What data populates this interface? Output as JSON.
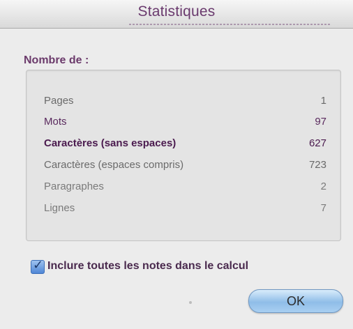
{
  "window": {
    "title": "Statistiques"
  },
  "stats": {
    "section_label": "Nombre de :",
    "rows": [
      {
        "label": "Pages",
        "value": "1"
      },
      {
        "label": "Mots",
        "value": "97"
      },
      {
        "label": "Caractères (sans espaces)",
        "value": "627"
      },
      {
        "label": "Caractères (espaces compris)",
        "value": "723"
      },
      {
        "label": "Paragraphes",
        "value": "2"
      },
      {
        "label": "Lignes",
        "value": "7"
      }
    ]
  },
  "options": {
    "include_notes_label": "Inclure toutes les notes dans le calcul",
    "include_notes_checked": true
  },
  "buttons": {
    "ok_label": "OK"
  },
  "colors": {
    "title": "#6a3a6e",
    "accent": "#4f86d6"
  }
}
